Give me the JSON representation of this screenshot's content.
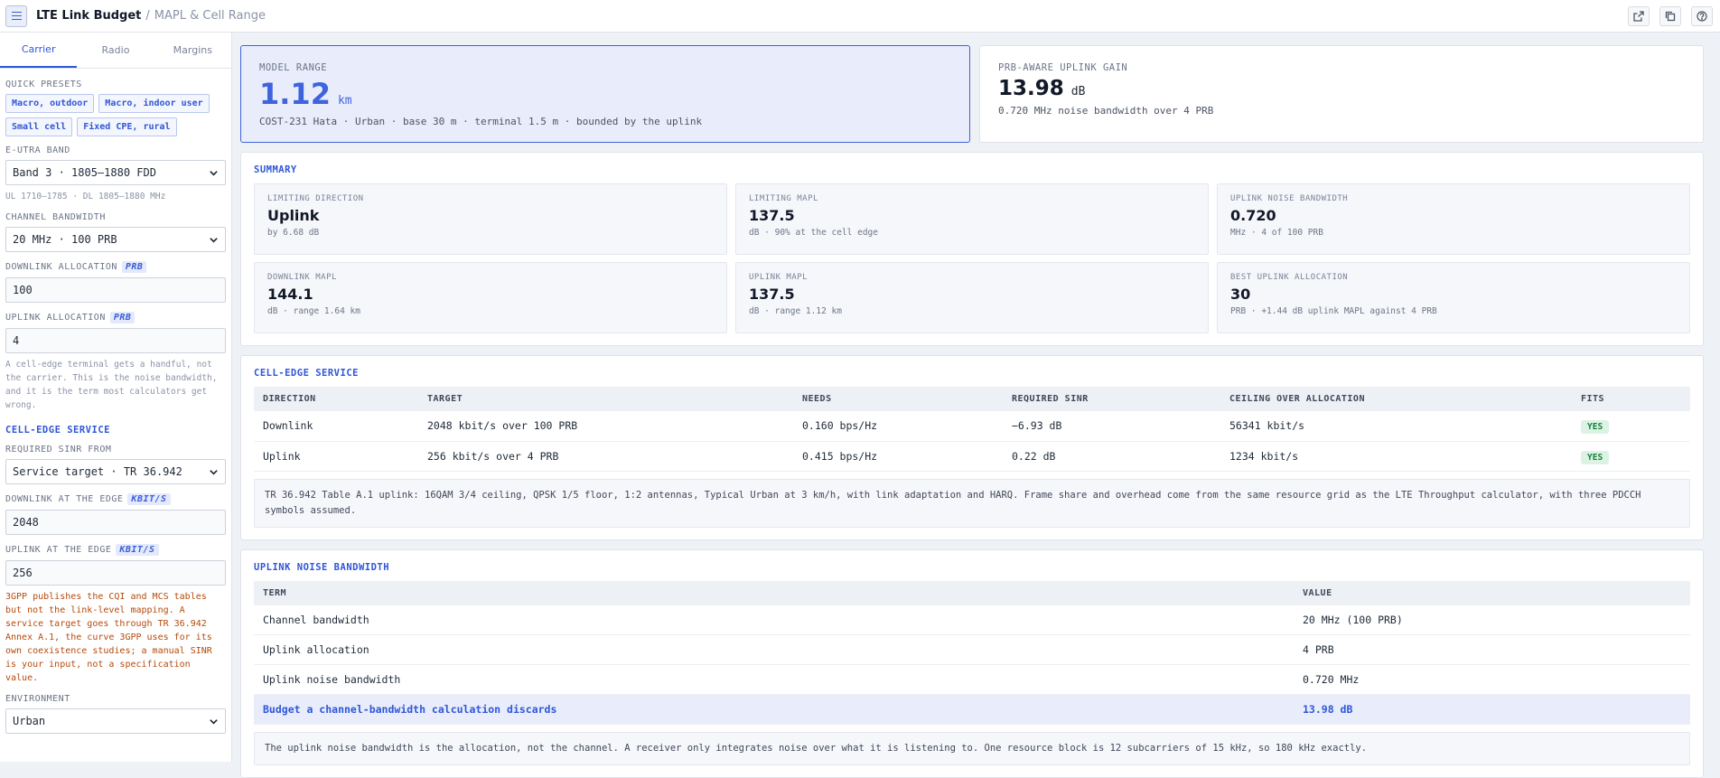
{
  "header": {
    "app_title": "LTE Link Budget",
    "separator": "/",
    "breadcrumb": "MAPL & Cell Range",
    "icons": [
      "external-link-icon",
      "copy-icon",
      "help-icon"
    ]
  },
  "sidebar": {
    "tabs": [
      "Carrier",
      "Radio",
      "Margins"
    ],
    "active_tab": "Carrier",
    "quick_presets_label": "QUICK PRESETS",
    "presets": [
      "Macro, outdoor",
      "Macro, indoor user",
      "Small cell",
      "Fixed CPE, rural"
    ],
    "band_label": "E-UTRA BAND",
    "band_value": "Band 3 · 1805–1880 FDD",
    "band_hint": "UL 1710–1785 · DL 1805–1880 MHz",
    "bandwidth_label": "CHANNEL BANDWIDTH",
    "bandwidth_value": "20 MHz · 100 PRB",
    "dl_alloc_label": "DOWNLINK ALLOCATION",
    "dl_alloc_unit": "PRB",
    "dl_alloc_value": "100",
    "ul_alloc_label": "UPLINK ALLOCATION",
    "ul_alloc_unit": "PRB",
    "ul_alloc_value": "4",
    "ul_alloc_hint": "A cell-edge terminal gets a handful, not the carrier. This is the noise bandwidth, and it is the term most calculators get wrong.",
    "edge_service_label": "CELL-EDGE SERVICE",
    "sinr_from_label": "REQUIRED SINR FROM",
    "sinr_from_value": "Service target · TR 36.942",
    "dl_edge_label": "DOWNLINK AT THE EDGE",
    "dl_edge_unit": "KBIT/S",
    "dl_edge_value": "2048",
    "ul_edge_label": "UPLINK AT THE EDGE",
    "ul_edge_unit": "KBIT/S",
    "ul_edge_value": "256",
    "warning": "3GPP publishes the CQI and MCS tables but not the link-level mapping. A service target goes through TR 36.942 Annex A.1, the curve 3GPP uses for its own coexistence studies; a manual SINR is your input, not a specification value.",
    "environment_label": "ENVIRONMENT",
    "environment_value": "Urban"
  },
  "hero": {
    "range_label": "MODEL RANGE",
    "range_value": "1.12",
    "range_unit": "km",
    "range_sub": "COST-231 Hata · Urban · base 30 m · terminal 1.5 m · bounded by the uplink",
    "gain_label": "PRB-AWARE UPLINK GAIN",
    "gain_value": "13.98",
    "gain_unit": "dB",
    "gain_sub": "0.720 MHz noise bandwidth over 4 PRB"
  },
  "summary": {
    "title": "SUMMARY",
    "cards": [
      {
        "label": "LIMITING DIRECTION",
        "value": "Uplink",
        "sub": "by 6.68 dB"
      },
      {
        "label": "LIMITING MAPL",
        "value": "137.5",
        "sub": "dB · 90% at the cell edge"
      },
      {
        "label": "UPLINK NOISE BANDWIDTH",
        "value": "0.720",
        "sub": "MHz · 4 of 100 PRB"
      },
      {
        "label": "DOWNLINK MAPL",
        "value": "144.1",
        "sub": "dB · range 1.64 km"
      },
      {
        "label": "UPLINK MAPL",
        "value": "137.5",
        "sub": "dB · range 1.12 km"
      },
      {
        "label": "BEST UPLINK ALLOCATION",
        "value": "30",
        "sub": "PRB · +1.44 dB uplink MAPL against 4 PRB"
      }
    ]
  },
  "service": {
    "title": "CELL-EDGE SERVICE",
    "headers": [
      "DIRECTION",
      "TARGET",
      "NEEDS",
      "REQUIRED SINR",
      "CEILING OVER ALLOCATION",
      "FITS"
    ],
    "rows": [
      {
        "direction": "Downlink",
        "target": "2048 kbit/s over 100 PRB",
        "needs": "0.160 bps/Hz",
        "sinr": "−6.93 dB",
        "ceiling": "56341 kbit/s",
        "fits": "YES"
      },
      {
        "direction": "Uplink",
        "target": "256 kbit/s over 4 PRB",
        "needs": "0.415 bps/Hz",
        "sinr": "0.22 dB",
        "ceiling": "1234 kbit/s",
        "fits": "YES"
      }
    ],
    "note": "TR 36.942 Table A.1 uplink: 16QAM 3/4 ceiling, QPSK 1/5 floor, 1:2 antennas, Typical Urban at 3 km/h, with link adaptation and HARQ. Frame share and overhead come from the same resource grid as the LTE Throughput calculator, with three PDCCH symbols assumed."
  },
  "noise": {
    "title": "UPLINK NOISE BANDWIDTH",
    "headers": [
      "TERM",
      "VALUE"
    ],
    "rows": [
      {
        "term": "Channel bandwidth",
        "value": "20 MHz (100 PRB)"
      },
      {
        "term": "Uplink allocation",
        "value": "4 PRB"
      },
      {
        "term": "Uplink noise bandwidth",
        "value": "0.720 MHz"
      },
      {
        "term": "Budget a channel-bandwidth calculation discards",
        "value": "13.98 dB"
      }
    ],
    "note": "The uplink noise bandwidth is the allocation, not the channel. A receiver only integrates noise over what it is listening to. One resource block is 12 subcarriers of 15 kHz, so 180 kHz exactly."
  }
}
